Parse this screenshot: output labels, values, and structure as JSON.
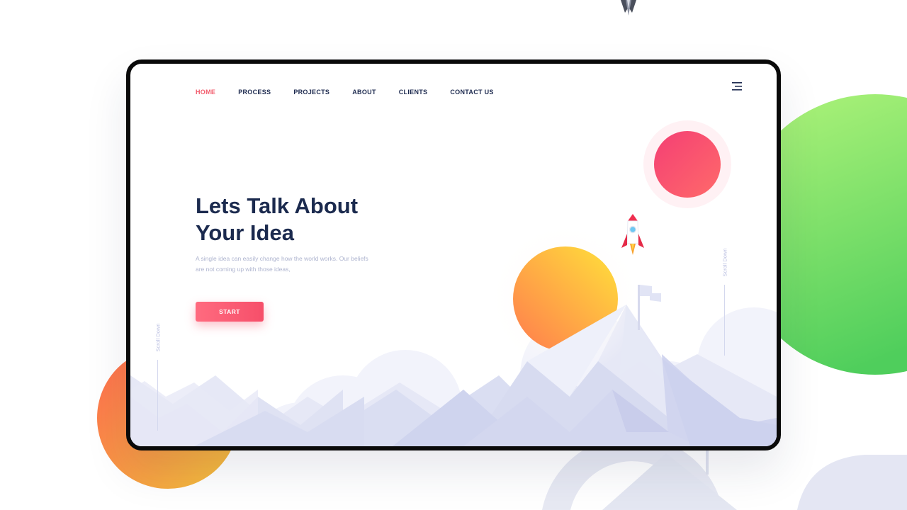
{
  "nav": {
    "items": [
      {
        "label": "HOME",
        "active": true
      },
      {
        "label": "PROCESS",
        "active": false
      },
      {
        "label": "PROJECTS",
        "active": false
      },
      {
        "label": "ABOUT",
        "active": false
      },
      {
        "label": "CLIENTS",
        "active": false
      },
      {
        "label": "CONTACT US",
        "active": false
      }
    ],
    "menu_icon": "hamburger-menu-icon"
  },
  "hero": {
    "title_line1": "Lets Talk About",
    "title_line2": "Your Idea",
    "desc_line1": "A single idea can easily change how the world works. Our beliefs",
    "desc_line2": "are not coming up with those ideas,",
    "cta_label": "START"
  },
  "scroll": {
    "left_label": "Scroll Down",
    "right_label": "Scroll Down"
  },
  "colors": {
    "accent": "#f25c6c",
    "title": "#1b2a4e",
    "nav_text": "#1d2a4f",
    "muted_text": "#aeb4cf",
    "mountain_light": "#e3e6f5",
    "mountain_dark": "#d0d4ee",
    "pink_ball": "#f64f6a",
    "orange_ball": "#fdae3f",
    "green_ball": "#6ad86b"
  },
  "icons": [
    "rocket-icon",
    "flag-icon",
    "hamburger-menu-icon"
  ]
}
